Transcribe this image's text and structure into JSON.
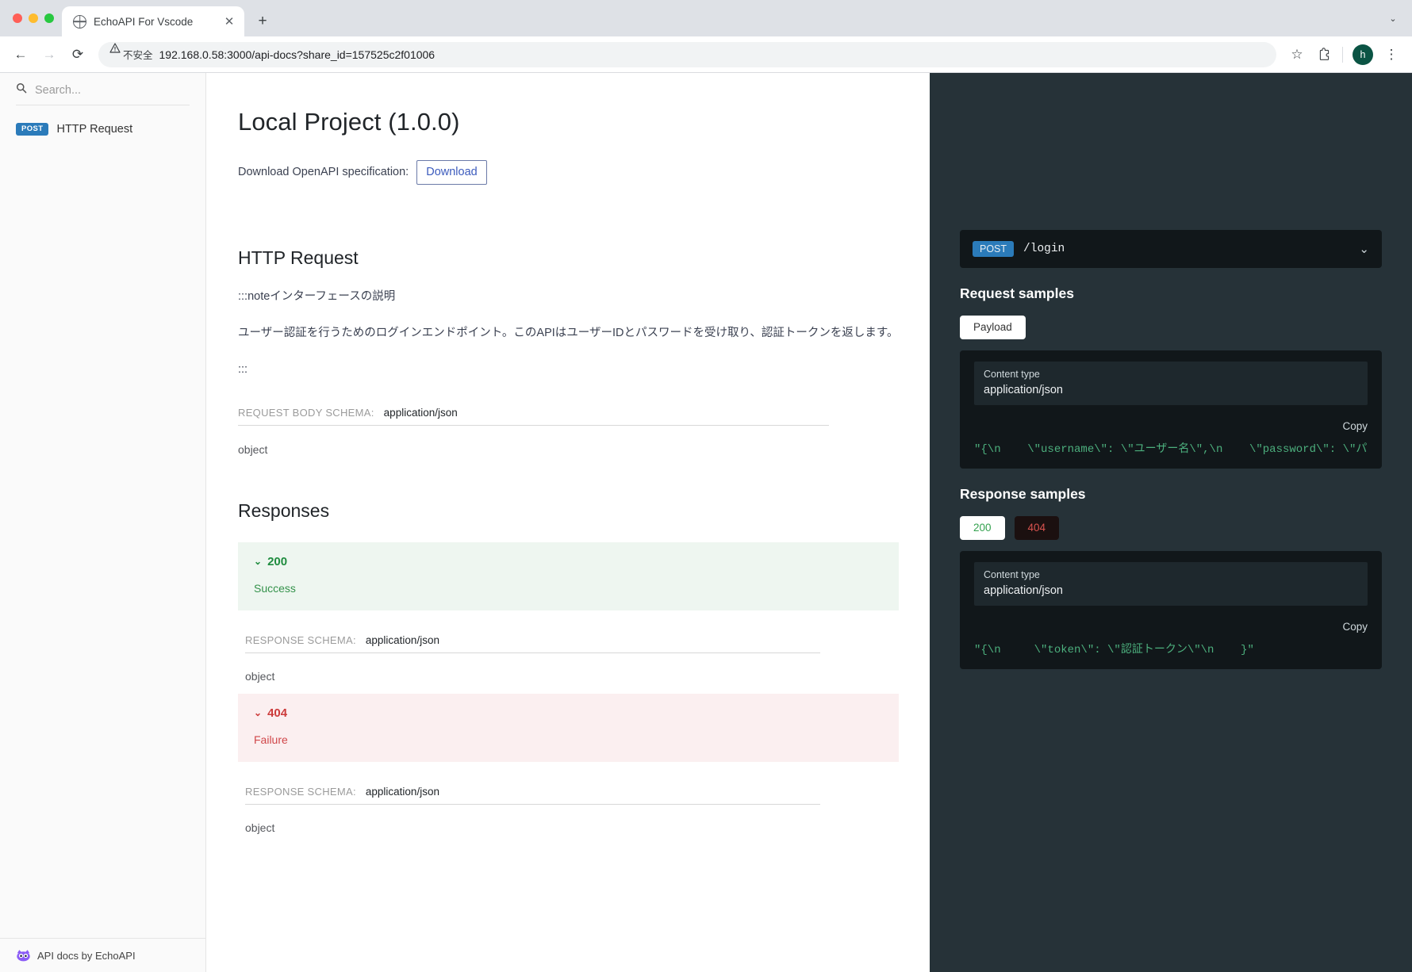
{
  "browser": {
    "tab_title": "EchoAPI For Vscode",
    "tab_close_glyph": "✕",
    "newtab_glyph": "+",
    "tabstrip_collapse_glyph": "⌄",
    "back_glyph": "←",
    "forward_glyph": "→",
    "reload_glyph": "⟳",
    "security_text": "不安全",
    "url": "192.168.0.58:3000/api-docs?share_id=157525c2f01006",
    "star_glyph": "☆",
    "profile_initial": "h",
    "menu_glyph": "⋮"
  },
  "sidebar": {
    "search_placeholder": "Search...",
    "search_value": "",
    "items": [
      {
        "method": "POST",
        "label": "HTTP Request"
      }
    ],
    "footer_text": "API docs by EchoAPI"
  },
  "main": {
    "title": "Local Project (1.0.0)",
    "download_label": "Download OpenAPI specification:",
    "download_button": "Download",
    "section_title": "HTTP Request",
    "paragraphs": [
      ":::noteインターフェースの説明",
      "ユーザー認証を行うためのログインエンドポイント。このAPIはユーザーIDとパスワードを受け取り、認証トークンを返します。",
      ":::"
    ],
    "request_body": {
      "label": "REQUEST BODY SCHEMA:",
      "value": "application/json",
      "type": "object"
    },
    "responses_title": "Responses",
    "responses": [
      {
        "code": "200",
        "description": "Success",
        "status": "ok",
        "chevron": "⌄",
        "schema_label": "RESPONSE SCHEMA:",
        "schema_value": "application/json",
        "schema_type": "object"
      },
      {
        "code": "404",
        "description": "Failure",
        "status": "err",
        "chevron": "⌄",
        "schema_label": "RESPONSE SCHEMA:",
        "schema_value": "application/json",
        "schema_type": "object"
      }
    ]
  },
  "panel": {
    "endpoint": {
      "method": "POST",
      "path": "/login",
      "chevron": "⌄"
    },
    "request_samples": {
      "heading": "Request samples",
      "tabs": [
        {
          "label": "Payload",
          "active": true
        }
      ],
      "content_type_label": "Content type",
      "content_type_value": "application/json",
      "copy_label": "Copy",
      "code": "\"{\\n    \\\"username\\\": \\\"ユーザー名\\\",\\n    \\\"password\\\": \\\"パスワ"
    },
    "response_samples": {
      "heading": "Response samples",
      "tabs": [
        {
          "label": "200",
          "active": true
        },
        {
          "label": "404",
          "active": false
        }
      ],
      "content_type_label": "Content type",
      "content_type_value": "application/json",
      "copy_label": "Copy",
      "code": "\"{\\n     \\\"token\\\": \\\"認証トークン\\\"\\n    }\""
    }
  }
}
